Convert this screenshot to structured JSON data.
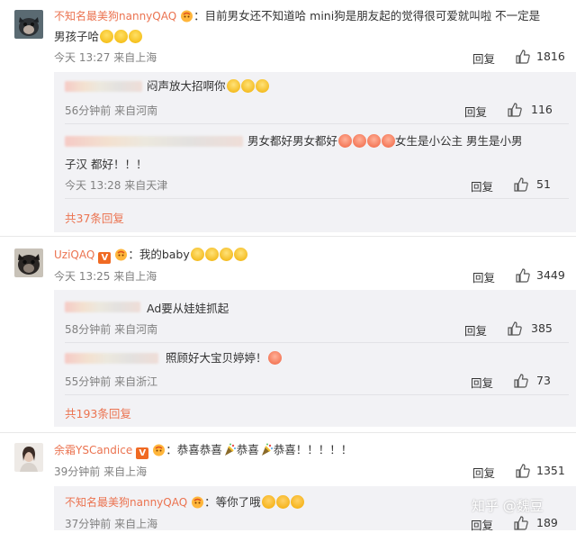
{
  "comments": [
    {
      "user": "不知名最美狗nannyQAQ",
      "text_line1": "：目前男女还不知道哈 mini狗是朋友起的觉得很可爱就叫啦 不一定是",
      "text_line2": "男孩子哈",
      "time": "今天 13:27",
      "location": "来自上海",
      "reply_label": "回复",
      "likes": "1816",
      "replies": [
        {
          "text": "闷声放大招啊你",
          "time": "56分钟前",
          "location": "来自河南",
          "reply_label": "回复",
          "likes": "116"
        },
        {
          "text_line1": "男女都好男女都好",
          "text_line1b": "女生是小公主 男生是小男",
          "text_line2": "子汉 都好！！！",
          "time": "今天 13:28",
          "location": "来自天津",
          "reply_label": "回复",
          "likes": "51"
        }
      ],
      "more": "共37条回复"
    },
    {
      "user": "UziQAQ",
      "text": "：我的baby",
      "time": "今天 13:25",
      "location": "来自上海",
      "reply_label": "回复",
      "likes": "3449",
      "replies": [
        {
          "text": "Ad要从娃娃抓起",
          "time": "58分钟前",
          "location": "来自河南",
          "reply_label": "回复",
          "likes": "385"
        },
        {
          "text": "照顾好大宝贝婷婷！",
          "time": "55分钟前",
          "location": "来自浙江",
          "reply_label": "回复",
          "likes": "73"
        }
      ],
      "more": "共193条回复"
    },
    {
      "user": "余霜YSCandice",
      "text_a": "：恭喜恭喜",
      "text_b": "恭喜",
      "text_c": "恭喜！！！！！",
      "time": "39分钟前",
      "location": "来自上海",
      "reply_label": "回复",
      "likes": "1351",
      "replies": [
        {
          "user": "不知名最美狗nannyQAQ",
          "text": "：等你了哦",
          "time": "37分钟前",
          "location": "来自上海",
          "reply_label": "回复",
          "likes": "189"
        }
      ]
    }
  ],
  "watermark": "知乎 @魏豆",
  "colors": {
    "username": "#eb7350",
    "reply_bg": "#f2f2f5",
    "meta": "#808080",
    "badge": "#f06a23"
  }
}
